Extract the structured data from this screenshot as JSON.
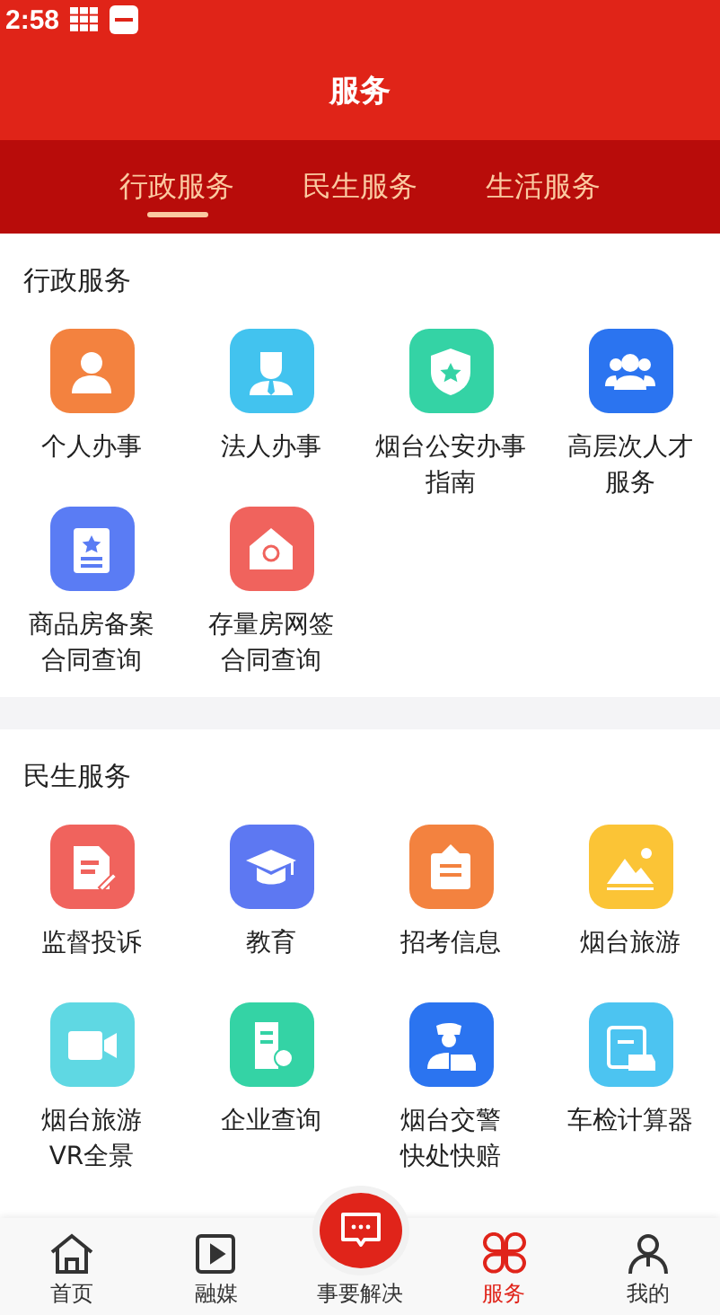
{
  "status_bar": {
    "time": "2:58"
  },
  "header": {
    "title": "服务"
  },
  "tabs": [
    {
      "label": "行政服务",
      "selected": true
    },
    {
      "label": "民生服务",
      "selected": false
    },
    {
      "label": "生活服务",
      "selected": false
    }
  ],
  "sections": [
    {
      "title": "行政服务",
      "items": [
        {
          "label": "个人办事",
          "kind": "person",
          "color": "#f3823f"
        },
        {
          "label": "法人办事",
          "kind": "businessman",
          "color": "#42c3ef"
        },
        {
          "label": "烟台公安办事指南",
          "kind": "shield",
          "color": "#34d3a5"
        },
        {
          "label": "高层次人才服务",
          "kind": "group",
          "color": "#2b74f0"
        },
        {
          "label": "商品房备案合同查询",
          "kind": "certificate",
          "color": "#5a7cf4"
        },
        {
          "label": "存量房网签合同查询",
          "kind": "house",
          "color": "#f0635d"
        }
      ]
    },
    {
      "title": "民生服务",
      "items": [
        {
          "label": "监督投诉",
          "kind": "document",
          "color": "#f0635d"
        },
        {
          "label": "教育",
          "kind": "cap",
          "color": "#5d78f2"
        },
        {
          "label": "招考信息",
          "kind": "notice",
          "color": "#f3823f"
        },
        {
          "label": "烟台旅游",
          "kind": "mountain",
          "color": "#fbc436"
        },
        {
          "label": "烟台旅游VR全景",
          "kind": "video",
          "color": "#5fd8e3"
        },
        {
          "label": "企业查询",
          "kind": "building",
          "color": "#34d3a5"
        },
        {
          "label": "烟台交警快处快赔",
          "kind": "police",
          "color": "#2b74f0"
        },
        {
          "label": "车检计算器",
          "kind": "calendar",
          "color": "#4cc4f1"
        }
      ]
    }
  ],
  "bottom_nav": [
    {
      "label": "首页",
      "kind": "home",
      "selected": false
    },
    {
      "label": "融媒",
      "kind": "media",
      "selected": false
    },
    {
      "label": "事要解决",
      "kind": "center",
      "selected": false
    },
    {
      "label": "服务",
      "kind": "services",
      "selected": true
    },
    {
      "label": "我的",
      "kind": "profile",
      "selected": false
    }
  ]
}
